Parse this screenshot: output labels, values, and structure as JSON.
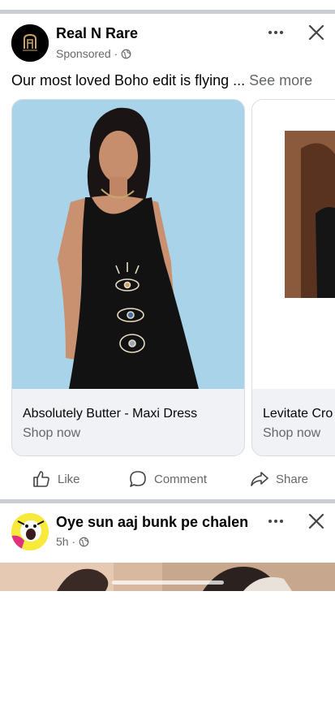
{
  "posts": [
    {
      "page_name": "Real N Rare",
      "meta": "Sponsored ·",
      "text": "Our most loved Boho edit is flying ... ",
      "see_more": "See more",
      "cards": [
        {
          "title": "Absolutely Butter - Maxi Dress",
          "cta": "Shop now"
        },
        {
          "title": "Levitate Cro",
          "cta": "Shop now"
        }
      ],
      "actions": {
        "like": "Like",
        "comment": "Comment",
        "share": "Share"
      }
    },
    {
      "page_name": "Oye sun aaj bunk pe chalen",
      "meta": "5h ·"
    }
  ],
  "icons": {
    "more": "more-options-icon",
    "close": "close-icon",
    "globe": "globe-icon",
    "like": "thumbs-up-icon",
    "comment": "speech-bubble-icon",
    "share": "share-arrow-icon"
  },
  "colors": {
    "secondary_text": "#65676b",
    "divider": "#c9ccd1",
    "card_bg": "#f0f2f5"
  }
}
